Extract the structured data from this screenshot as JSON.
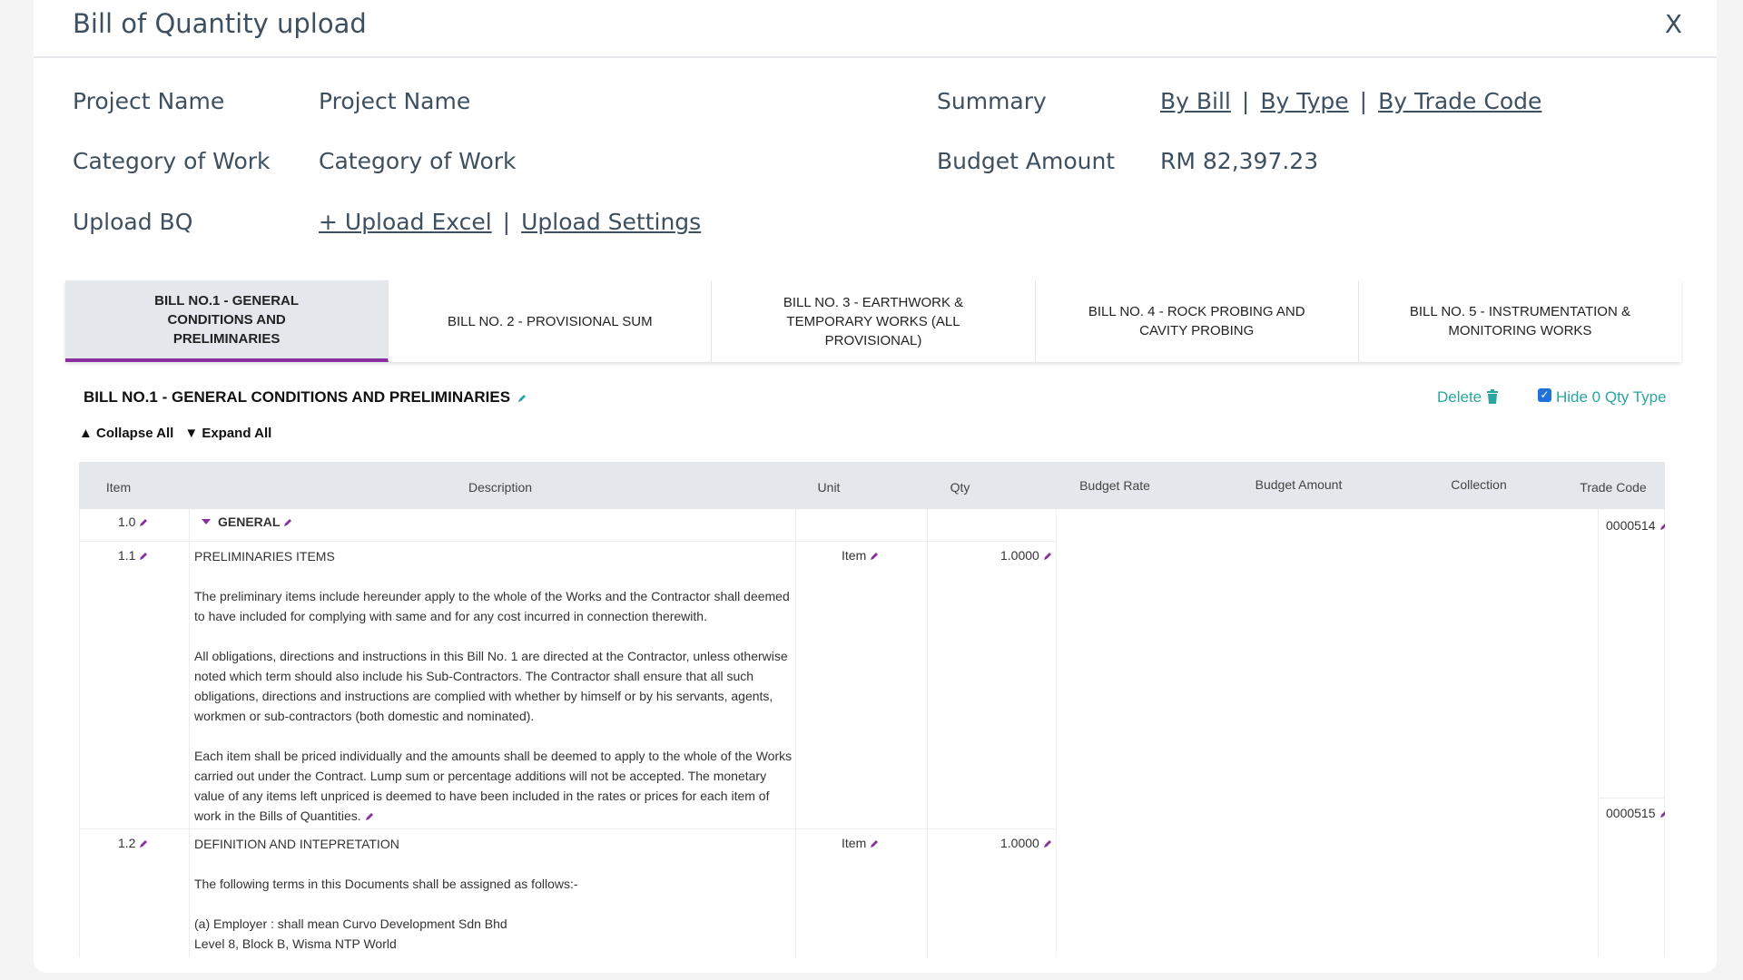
{
  "modal": {
    "title": "Bill of Quantity upload",
    "close_label": "X"
  },
  "info": {
    "project_name_label": "Project Name",
    "project_name_value": "Project Name",
    "category_label": "Category of Work",
    "category_value": "Category of Work",
    "upload_label": "Upload BQ",
    "upload_excel": "+ Upload Excel",
    "upload_settings": "Upload Settings",
    "summary_label": "Summary",
    "summary_by_bill": "By Bill",
    "summary_by_type": "By Type",
    "summary_by_trade": "By Trade Code",
    "budget_label": "Budget Amount",
    "budget_value": "RM 82,397.23",
    "separator": "|"
  },
  "tabs": [
    {
      "label": "BILL NO.1 - GENERAL CONDITIONS AND PRELIMINARIES",
      "active": true
    },
    {
      "label": "BILL NO. 2 - PROVISIONAL SUM",
      "active": false
    },
    {
      "label": "BILL NO. 3 - EARTHWORK & TEMPORARY WORKS (ALL PROVISIONAL)",
      "active": false
    },
    {
      "label": "BILL NO. 4 - ROCK PROBING AND CAVITY PROBING",
      "active": false
    },
    {
      "label": "BILL NO. 5 - INSTRUMENTATION & MONITORING WORKS",
      "active": false
    }
  ],
  "bill": {
    "heading": "BILL NO.1 - GENERAL CONDITIONS AND PRELIMINARIES",
    "delete_label": "Delete",
    "hide_qty_label": "Hide 0 Qty Type",
    "hide_qty_checked": true,
    "collapse_all": "▲ Collapse All",
    "expand_all": "▼ Expand All"
  },
  "table": {
    "headers": {
      "item": "Item",
      "description": "Description",
      "unit": "Unit",
      "qty": "Qty",
      "budget_rate": "Budget Rate",
      "budget_amount": "Budget Amount",
      "collection": "Collection",
      "trade_code": "Trade Code"
    },
    "rows": [
      {
        "item": "1.0",
        "description_title": "GENERAL",
        "trade_code": "0000514"
      },
      {
        "item": "1.1",
        "description_title": "PRELIMINARIES ITEMS",
        "paragraphs": [
          "The preliminary items include hereunder apply to the whole of the Works and the Contractor shall deemed to have included for complying with same and for any cost incurred in connection therewith.",
          " All obligations, directions and instructions in this Bill No. 1 are directed at the Contractor, unless otherwise noted which term should also include his Sub-Contractors. The Contractor shall ensure that all such obligations, directions and instructions are complied with whether by himself or by his servants, agents, workmen or sub-contractors (both domestic and nominated).",
          " Each item shall be priced individually and the amounts shall be deemed to apply to the whole of the Works carried out under the Contract. Lump sum or percentage additions will not be accepted. The monetary value of any items left unpriced is deemed to have been included in the rates or prices for each item of work in the Bills of Quantities."
        ],
        "unit": "Item",
        "qty": "1.0000",
        "trade_code": "0000515"
      },
      {
        "item": "1.2",
        "description_title": "DEFINITION AND INTEPRETATION",
        "paragraphs": [
          "The following terms in this Documents shall be assigned as follows:-",
          " (a) Employer : shall mean Curvo Development Sdn Bhd\nLevel 8, Block B, Wisma NTP World"
        ],
        "unit": "Item",
        "qty": "1.0000"
      }
    ]
  },
  "colors": {
    "accent_purple": "#8a2f9e",
    "teal": "#2aa5a0",
    "header_text": "#3e5060",
    "table_header_bg": "#e4e7eb"
  },
  "icons": {
    "edit": "pencil-icon",
    "delete": "trash-icon",
    "expand": "caret-down-icon"
  }
}
